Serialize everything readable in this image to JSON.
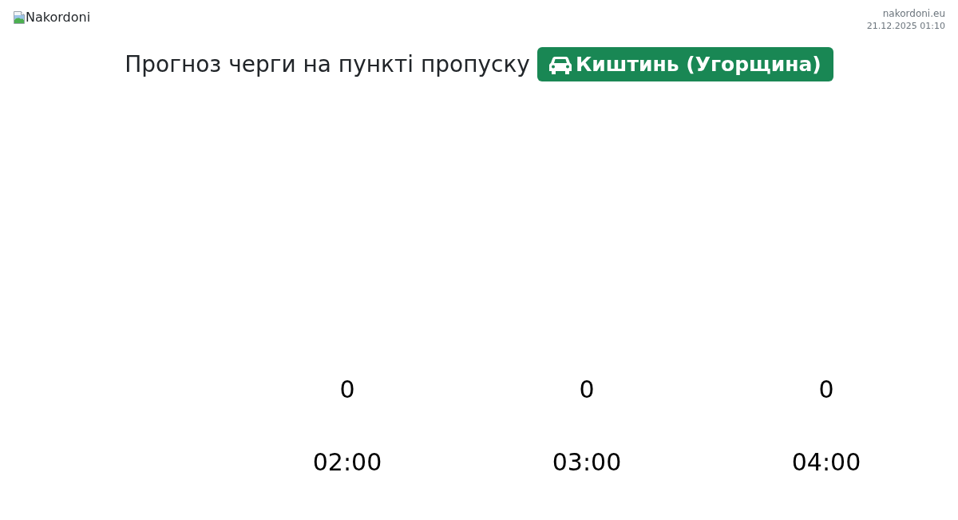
{
  "header": {
    "logo_alt": "Nakordoni",
    "site": "nakordoni.eu",
    "updated": "21.12.2025 01:10"
  },
  "title": {
    "text": "Прогноз черги на пункті пропуску",
    "checkpoint": {
      "kind": "car",
      "label": "Киштинь (Угорщина)"
    }
  },
  "forecast": [
    {
      "queue": "0",
      "time": "02:00"
    },
    {
      "queue": "0",
      "time": "03:00"
    },
    {
      "queue": "0",
      "time": "04:00"
    }
  ]
}
